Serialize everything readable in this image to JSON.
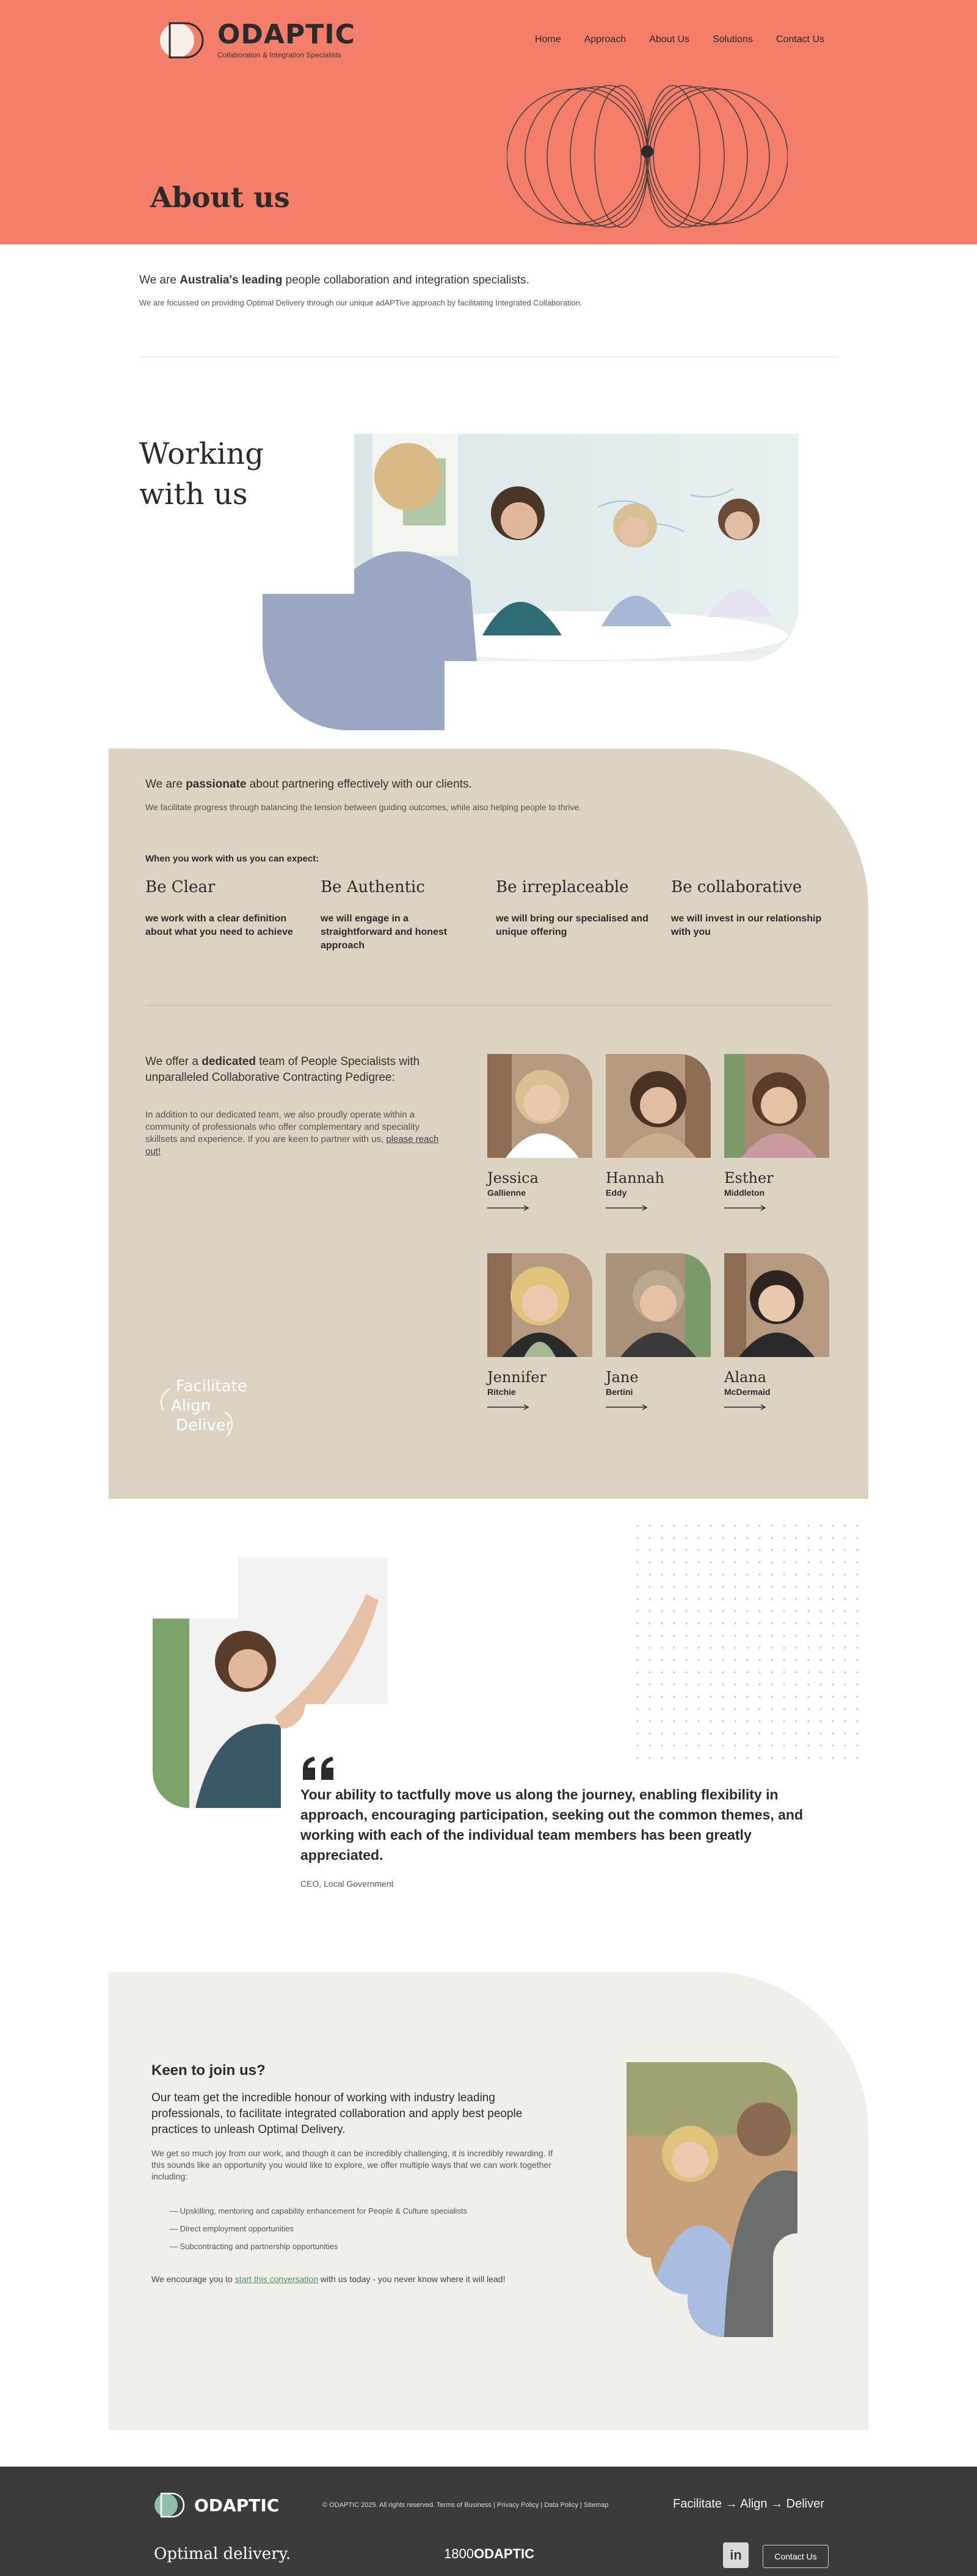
{
  "header": {
    "brand": "ODAPTIC",
    "tagline": "Collaboration & Integration Specialists",
    "nav": [
      "Home",
      "Approach",
      "About Us",
      "Solutions",
      "Contact Us"
    ],
    "title": "About us"
  },
  "intro": {
    "lead_pre": "We are ",
    "lead_bold": "Australia's leading",
    "lead_post": " people collaboration and integration specialists.",
    "sub": "We are focussed on providing Optimal Delivery through our unique adAPTive approach by facilitating Integrated Collaboration."
  },
  "working": {
    "title_line1": "Working",
    "title_line2": "with us"
  },
  "partnering": {
    "lead_pre": "We are ",
    "lead_bold": "passionate",
    "lead_post": " about partnering effectively with our clients.",
    "sub": "We facilitate progress through balancing the tension between guiding outcomes, while also helping people to thrive.",
    "expect": "When you work with us you can expect:",
    "values": [
      {
        "title": "Be Clear",
        "text": "we work with a clear definition about what you need to achieve"
      },
      {
        "title": "Be Authentic",
        "text": "we will engage in a straightforward and honest approach"
      },
      {
        "title": "Be irreplaceable",
        "text": "we will bring our specialised and unique offering"
      },
      {
        "title": "Be collaborative",
        "text": "we will invest in our relationship with you"
      }
    ]
  },
  "team": {
    "lead_pre": "We offer a ",
    "lead_bold": "dedicated",
    "lead_post": " team of People Specialists with unparalleled Collaborative Contracting Pedigree:",
    "sub": "In addition to our dedicated team, we also proudly operate within a community of professionals who offer complementary and speciality skillsets and experience. If you are keen to partner with us, ",
    "sub_link": "please reach out!",
    "members": [
      {
        "first": "Jessica",
        "last": "Gallienne",
        "hair": "#d8bf94",
        "top": "#ffffff"
      },
      {
        "first": "Hannah",
        "last": "Eddy",
        "hair": "#4a3325",
        "top": "#c9ad8c"
      },
      {
        "first": "Esther",
        "last": "Middleton",
        "hair": "#5a3c2a",
        "top": "#c99ba0"
      },
      {
        "first": "Jennifer",
        "last": "Ritchie",
        "hair": "#e0c27a",
        "top": "#a5b893"
      },
      {
        "first": "Jane",
        "last": "Bertini",
        "hair": "#b9a78e",
        "top": "#3a3a3a"
      },
      {
        "first": "Alana",
        "last": "McDermaid",
        "hair": "#2d2320",
        "top": "#2a2a2a"
      }
    ],
    "script_words": [
      "Facilitate",
      "Align",
      "Deliver"
    ]
  },
  "testimonial": {
    "quote": "Your ability to tactfully move us along the journey, enabling flexibility in approach, encouraging participation, seeking out the common themes, and working with each of the individual team members has been greatly appreciated.",
    "cite": "CEO, Local Government"
  },
  "join": {
    "title": "Keen to join us?",
    "lead": "Our team get the incredible honour of working with industry leading professionals, to facilitate integrated collaboration and apply best people practices to unleash Optimal Delivery.",
    "sub": "We get so much joy from our work, and though it can be incredibly challenging, it is incredibly rewarding. If this sounds like an opportunity you would like to explore, we offer multiple ways that we can work together including:",
    "items": [
      "— Upskilling, mentoring and capability enhancement for People & Culture specialists",
      "— Direct employment opportunities",
      "— Subcontracting and partnership opportunities"
    ],
    "foot_pre": "We encourage you to ",
    "foot_link": "start this conversation",
    "foot_post": " with us today - you never know where it will lead!"
  },
  "footer": {
    "brand": "ODAPTIC",
    "copyright": "© ODAPTIC 2025. All rights reserved.",
    "links": [
      "Terms of Business",
      "Privacy Policy",
      "Data Policy",
      "Sitemap"
    ],
    "tagline": "Facilitate → Align → Deliver",
    "slogan": "Optimal delivery.",
    "phone_pre": "1800",
    "phone_bold": "ODAPTIC",
    "linkedin": "in",
    "contact": "Contact Us"
  },
  "colors": {
    "hero": "#f47e69",
    "beige": "#dcd3c3",
    "cream": "#f1efe9",
    "footer": "#3b3b3b",
    "text": "#2b2b2b"
  }
}
